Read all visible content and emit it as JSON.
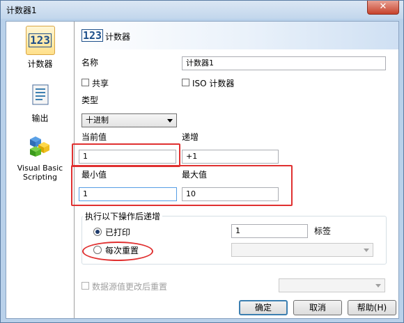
{
  "window": {
    "title": "计数器1",
    "close_label": "✕"
  },
  "sidebar": {
    "items": [
      {
        "label": "计数器",
        "icon": "counter-icon",
        "icon_text": "123"
      },
      {
        "label": "输出",
        "icon": "output-icon"
      },
      {
        "label": "Visual Basic Scripting",
        "icon": "vbscript-icon"
      }
    ]
  },
  "header": {
    "icon_text": "123",
    "title": "计数器"
  },
  "form": {
    "name_label": "名称",
    "name_value": "计数器1",
    "shared_label": "共享",
    "iso_label": "ISO 计数器",
    "type_label": "类型",
    "type_value": "十进制",
    "current_label": "当前值",
    "current_value": "1",
    "increment_label": "递增",
    "increment_value": "+1",
    "min_label": "最小值",
    "min_value": "1",
    "max_label": "最大值",
    "max_value": "10",
    "group_title": "执行以下操作后递增",
    "printed_label": "已打印",
    "printed_value": "1",
    "tag_label": "标签",
    "reset_label": "每次重置",
    "reset_combo_value": "",
    "datasource_label": "数据源值更改后重置",
    "datasource_combo_value": ""
  },
  "buttons": {
    "ok": "确定",
    "cancel": "取消",
    "help": "帮助(H)"
  },
  "colors": {
    "annotation": "#e03030",
    "accent": "#3c7fb1",
    "title_bar": "#c2d6ec"
  }
}
